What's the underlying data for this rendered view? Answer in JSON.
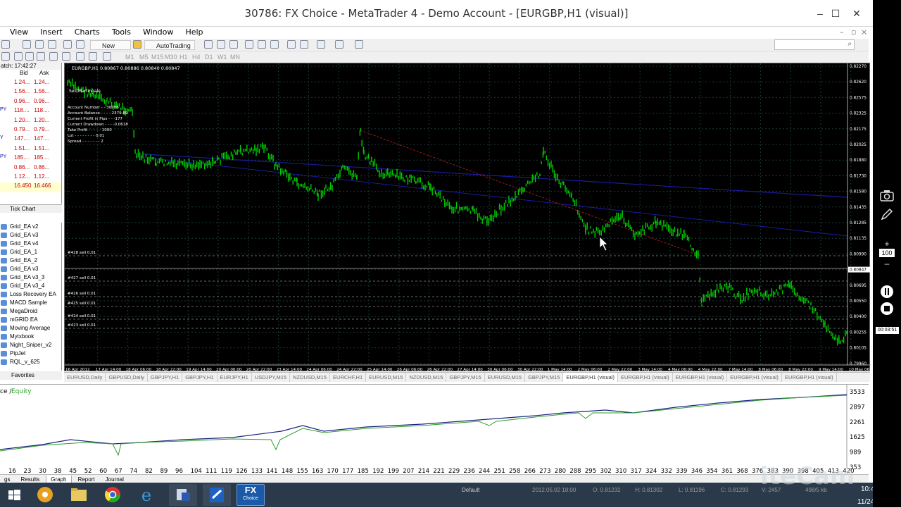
{
  "window": {
    "title": "30786: FX Choice - MetaTrader 4 - Demo Account - [EURGBP,H1 (visual)]",
    "minimize": "–",
    "maximize": "☐",
    "close": "✕"
  },
  "menu": [
    "View",
    "Insert",
    "Charts",
    "Tools",
    "Window",
    "Help"
  ],
  "toolbar": {
    "new_order": "New Order",
    "autotrading": "AutoTrading",
    "timeframes": [
      "M1",
      "M5",
      "M15",
      "M30",
      "H1",
      "H4",
      "D1",
      "W1",
      "MN"
    ]
  },
  "market_watch": {
    "header": "atch: 17:42:27",
    "col_bid": "Bid",
    "col_ask": "Ask",
    "rows": [
      {
        "s": "",
        "bid": "1.24...",
        "ask": "1.24..."
      },
      {
        "s": "",
        "bid": "1.56...",
        "ask": "1.56..."
      },
      {
        "s": "",
        "bid": "0.96...",
        "ask": "0.96..."
      },
      {
        "s": "PY",
        "bid": "118....",
        "ask": "118...."
      },
      {
        "s": "",
        "bid": "1.20...",
        "ask": "1.20..."
      },
      {
        "s": "",
        "bid": "0.79...",
        "ask": "0.79..."
      },
      {
        "s": "Y",
        "bid": "147....",
        "ask": "147...."
      },
      {
        "s": "",
        "bid": "1.51...",
        "ask": "1.51..."
      },
      {
        "s": "PY",
        "bid": "185....",
        "ask": "185...."
      },
      {
        "s": "",
        "bid": "0.86...",
        "ask": "0.86..."
      },
      {
        "s": "",
        "bid": "1.12...",
        "ask": "1.12..."
      },
      {
        "s": "",
        "bid": "16.450",
        "ask": "16.466"
      }
    ],
    "tick_chart": "Tick Chart"
  },
  "navigator": {
    "items": [
      "Grid_EA v2",
      "Grid_EA v3",
      "Grid_EA v4",
      "Grid_EA_1",
      "Grid_EA_2",
      "Grid_EA v3",
      "Grid_EA v3_3",
      "Grid_EA v3_4",
      "Loss Recovery EA",
      "MACD Sample",
      "MegaDroid",
      "mGRID EA",
      "Moving Average",
      "Mytxbook",
      "Night_Sniper_v2",
      "PipJet",
      "RQL_v_625"
    ],
    "favorites": "Favorites"
  },
  "chart": {
    "header": "EURGBP,H1  0.80867 0.80886 0.80840 0.80847",
    "info_title": "Sell/Martingale",
    "info_lines": [
      "Account Number - - 30786",
      "Account Balance - - - - 2379.89",
      "Current Profit in Pips - - -177",
      "Current Drawdown - - - -0.0618",
      "Take Profit - - - - - 1000",
      "Lot - - - - - - - - 0.01",
      "Spread - - - - - - - 2"
    ],
    "orders": [
      "#428 sell 0.01",
      "#427 sell 0.01",
      "#426 sell 0.01",
      "#425 sell 0.01",
      "#424 sell 0.01",
      "#423 sell 0.01"
    ],
    "price_labels": [
      "0.82270",
      "0.82620",
      "0.82575",
      "0.82325",
      "0.82175",
      "0.82025",
      "0.81880",
      "0.81730",
      "0.81580",
      "0.81435",
      "0.81285",
      "0.81135",
      "0.80990",
      "0.80847",
      "0.80695",
      "0.80550",
      "0.80400",
      "0.80255",
      "0.80105",
      "0.79960"
    ],
    "current_price": "0.80847",
    "time_labels": [
      "16 Apr 2012",
      "17 Apr 14:00",
      "18 Apr 06:00",
      "18 Apr 22:00",
      "19 Apr 14:00",
      "20 Apr 06:00",
      "20 Apr 22:00",
      "23 Apr 14:00",
      "24 Apr 06:00",
      "24 Apr 22:00",
      "25 Apr 14:00",
      "26 Apr 06:00",
      "26 Apr 22:00",
      "27 Apr 14:00",
      "30 Apr 06:00",
      "30 Apr 22:00",
      "1 May 14:00",
      "2 May 06:00",
      "2 May 22:00",
      "3 May 14:00",
      "4 May 06:00",
      "4 May 22:00",
      "7 May 14:00",
      "8 May 06:00",
      "8 May 22:00",
      "9 May 14:00",
      "10 May 06:00"
    ],
    "colors": {
      "bg": "#000000",
      "candle": "#00cc00",
      "grid": "#1c3a3a",
      "trend1": "#1a1aa0",
      "trend2": "#a01a1a",
      "text": "#ffffff"
    }
  },
  "tabs": [
    "EURUSD,Daily",
    "GBPUSD,Daily",
    "GBPJPY,H1",
    "GBPJPY,H1",
    "EURJPY,H1",
    "USDJPY,M15",
    "NZDUSD,M15",
    "EURCHF,H1",
    "EURUSD,M15",
    "NZDUSD,M15",
    "GBPJPY,M15",
    "EURUSD,M15",
    "GBPJPY,M15",
    "EURGBP,H1 (visual)",
    "EURGBP,H1 (visual)",
    "EURGBP,H1 (visual)",
    "EURGBP,H1 (visual)",
    "EURGBP,H1 (visual)"
  ],
  "graph": {
    "legend_a": "ce /",
    "legend_b": "Equity",
    "y_labels": [
      "3533",
      "2897",
      "2261",
      "1625",
      "989",
      "353"
    ],
    "x_labels": [
      "16",
      "23",
      "30",
      "38",
      "45",
      "52",
      "60",
      "67",
      "74",
      "82",
      "89",
      "96",
      "104",
      "111",
      "119",
      "126",
      "133",
      "141",
      "148",
      "155",
      "163",
      "170",
      "177",
      "185",
      "192",
      "199",
      "207",
      "214",
      "221",
      "229",
      "236",
      "244",
      "251",
      "258",
      "266",
      "273",
      "280",
      "288",
      "295",
      "302",
      "310",
      "317",
      "324",
      "332",
      "339",
      "346",
      "354",
      "361",
      "368",
      "376",
      "383",
      "390",
      "398",
      "405",
      "413",
      "420"
    ],
    "colors": {
      "balance": "#1a237e",
      "equity": "#2e9d2e"
    }
  },
  "bottom_tabs": [
    "gs",
    "Results",
    "Graph",
    "Report",
    "Journal"
  ],
  "status": {
    "profile": "Default",
    "time": "2012.05.02 18:00",
    "o": "O: 0.81232",
    "h": "H: 0.81302",
    "l": "L: 0.81196",
    "c": "C: 0.81293",
    "v": "V: 2457",
    "kb": "498/5 kb",
    "clock": "10:4",
    "date": "11/24"
  },
  "taskbar": {
    "fx_label": "FX",
    "fx_sub": "Choice"
  },
  "recorder": {
    "zoom": "100",
    "timer": "00:03:51",
    "watermark": "iteCam"
  }
}
